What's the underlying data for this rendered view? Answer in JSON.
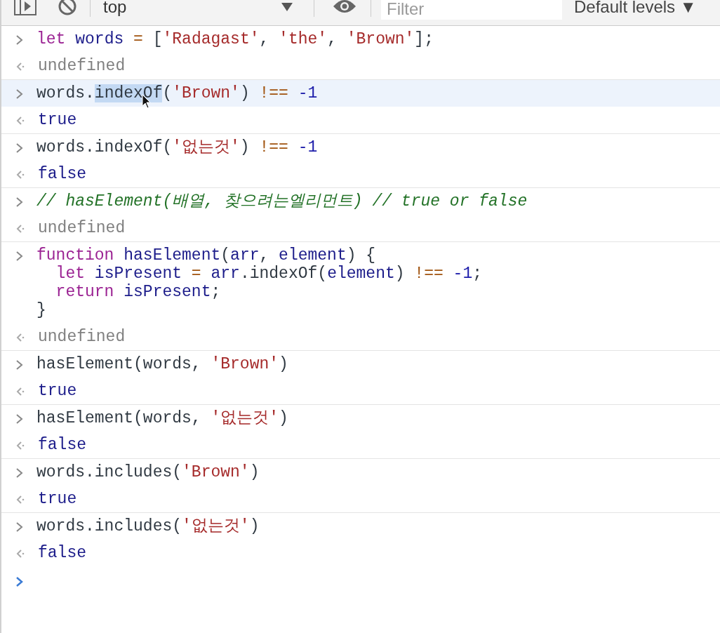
{
  "toolbar": {
    "context": "top",
    "filter": {
      "placeholder": "Filter"
    },
    "levels": "Default levels ▼"
  },
  "entries": [
    {
      "kind": "input",
      "selected": false,
      "lines": [
        [
          {
            "kind": "keyword",
            "text": "let "
          },
          {
            "kind": "variable",
            "text": "words "
          },
          {
            "kind": "operator",
            "text": "= "
          },
          {
            "kind": "plain",
            "text": "["
          },
          {
            "kind": "string",
            "text": "'Radagast'"
          },
          {
            "kind": "plain",
            "text": ", "
          },
          {
            "kind": "string",
            "text": "'the'"
          },
          {
            "kind": "plain",
            "text": ", "
          },
          {
            "kind": "string",
            "text": "'Brown'"
          },
          {
            "kind": "plain",
            "text": "];"
          }
        ]
      ]
    },
    {
      "kind": "undefined_result",
      "selected": false,
      "value": "undefined"
    },
    {
      "kind": "input",
      "selected": true,
      "lines": [
        [
          {
            "kind": "plain",
            "text": "words."
          },
          {
            "kind": "selected_text",
            "text": "indexOf"
          },
          {
            "kind": "plain",
            "text": "("
          },
          {
            "kind": "string",
            "text": "'Brown'"
          },
          {
            "kind": "plain",
            "text": ") "
          },
          {
            "kind": "operator",
            "text": "!== "
          },
          {
            "kind": "number",
            "text": "-1"
          }
        ]
      ]
    },
    {
      "kind": "value_result",
      "selected": false,
      "value": "true"
    },
    {
      "kind": "input",
      "selected": false,
      "lines": [
        [
          {
            "kind": "plain",
            "text": "words.indexOf("
          },
          {
            "kind": "string",
            "text": "'없는것'"
          },
          {
            "kind": "plain",
            "text": ") "
          },
          {
            "kind": "operator",
            "text": "!== "
          },
          {
            "kind": "number",
            "text": "-1"
          }
        ]
      ]
    },
    {
      "kind": "value_result",
      "selected": false,
      "value": "false"
    },
    {
      "kind": "input",
      "selected": false,
      "lines": [
        [
          {
            "kind": "comment",
            "text": "// hasElement(배열, 찾으려는엘리먼트) // true or false"
          }
        ]
      ]
    },
    {
      "kind": "undefined_result",
      "selected": false,
      "value": "undefined"
    },
    {
      "kind": "input",
      "selected": false,
      "lines": [
        [
          {
            "kind": "keyword",
            "text": "function "
          },
          {
            "kind": "variable",
            "text": "hasElement"
          },
          {
            "kind": "plain",
            "text": "("
          },
          {
            "kind": "variable",
            "text": "arr"
          },
          {
            "kind": "plain",
            "text": ", "
          },
          {
            "kind": "variable",
            "text": "element"
          },
          {
            "kind": "plain",
            "text": ") {"
          }
        ],
        [
          {
            "kind": "keyword",
            "text": "  let "
          },
          {
            "kind": "variable",
            "text": "isPresent "
          },
          {
            "kind": "operator",
            "text": "= "
          },
          {
            "kind": "variable",
            "text": "arr"
          },
          {
            "kind": "plain",
            "text": ".indexOf("
          },
          {
            "kind": "variable",
            "text": "element"
          },
          {
            "kind": "plain",
            "text": ") "
          },
          {
            "kind": "operator",
            "text": "!== "
          },
          {
            "kind": "number",
            "text": "-1"
          },
          {
            "kind": "plain",
            "text": ";"
          }
        ],
        [
          {
            "kind": "keyword",
            "text": "  return "
          },
          {
            "kind": "variable",
            "text": "isPresent"
          },
          {
            "kind": "plain",
            "text": ";"
          }
        ],
        [
          {
            "kind": "plain",
            "text": "}"
          }
        ]
      ]
    },
    {
      "kind": "undefined_result",
      "selected": false,
      "value": "undefined"
    },
    {
      "kind": "input",
      "selected": false,
      "lines": [
        [
          {
            "kind": "plain",
            "text": "hasElement(words, "
          },
          {
            "kind": "string",
            "text": "'Brown'"
          },
          {
            "kind": "plain",
            "text": ")"
          }
        ]
      ]
    },
    {
      "kind": "value_result",
      "selected": false,
      "value": "true"
    },
    {
      "kind": "input",
      "selected": false,
      "lines": [
        [
          {
            "kind": "plain",
            "text": "hasElement(words, "
          },
          {
            "kind": "string",
            "text": "'없는것'"
          },
          {
            "kind": "plain",
            "text": ")"
          }
        ]
      ]
    },
    {
      "kind": "value_result",
      "selected": false,
      "value": "false"
    },
    {
      "kind": "input",
      "selected": false,
      "lines": [
        [
          {
            "kind": "plain",
            "text": "words.includes("
          },
          {
            "kind": "string",
            "text": "'Brown'"
          },
          {
            "kind": "plain",
            "text": ")"
          }
        ]
      ]
    },
    {
      "kind": "value_result",
      "selected": false,
      "value": "true"
    },
    {
      "kind": "input",
      "selected": false,
      "lines": [
        [
          {
            "kind": "plain",
            "text": "words.includes("
          },
          {
            "kind": "string",
            "text": "'없는것'"
          },
          {
            "kind": "plain",
            "text": ")"
          }
        ]
      ]
    },
    {
      "kind": "value_result",
      "selected": false,
      "value": "false"
    }
  ]
}
